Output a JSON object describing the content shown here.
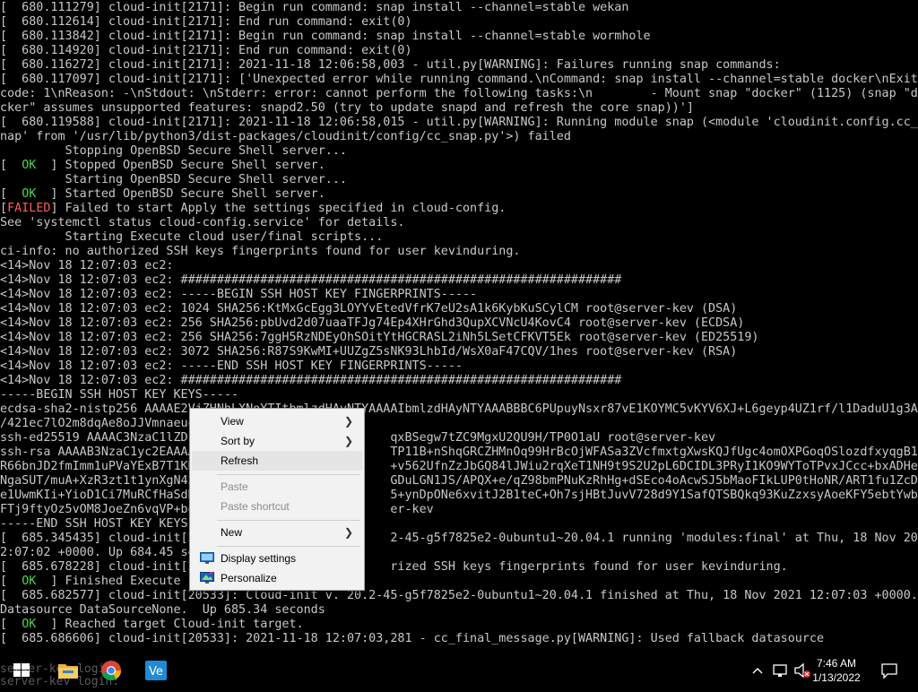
{
  "console": {
    "lines": [
      "[  680.111279] cloud-init[2171]: Begin run command: snap install --channel=stable wekan",
      "[  680.112614] cloud-init[2171]: End run command: exit(0)",
      "[  680.113842] cloud-init[2171]: Begin run command: snap install --channel=stable wormhole",
      "[  680.114920] cloud-init[2171]: End run command: exit(0)",
      "[  680.116272] cloud-init[2171]: 2021-11-18 12:06:58,003 - util.py[WARNING]: Failures running snap commands:",
      "[  680.117097] cloud-init[2171]: ['Unexpected error while running command.\\nCommand: snap install --channel=stable docker\\nExit",
      "code: 1\\nReason: -\\nStdout: \\nStderr: error: cannot perform the following tasks:\\n        - Mount snap \"docker\" (1125) (snap \"do",
      "cker\" assumes unsupported features: snapd2.50 (try to update snapd and refresh the core snap))']",
      "[  680.119588] cloud-init[2171]: 2021-11-18 12:06:58,015 - util.py[WARNING]: Running module snap (<module 'cloudinit.config.cc_s",
      "nap' from '/usr/lib/python3/dist-packages/cloudinit/config/cc_snap.py'>) failed",
      "         Stopping OpenBSD Secure Shell server...",
      "[  OK  ] Stopped OpenBSD Secure Shell server.",
      "         Starting OpenBSD Secure Shell server...",
      "[  OK  ] Started OpenBSD Secure Shell server.",
      "[FAILED] Failed to start Apply the settings specified in cloud-config.",
      "See 'systemctl status cloud-config.service' for details.",
      "         Starting Execute cloud user/final scripts...",
      "ci-info: no authorized SSH keys fingerprints found for user kevinduring.",
      "<14>Nov 18 12:07:03 ec2:",
      "<14>Nov 18 12:07:03 ec2: #############################################################",
      "<14>Nov 18 12:07:03 ec2: -----BEGIN SSH HOST KEY FINGERPRINTS-----",
      "<14>Nov 18 12:07:03 ec2: 1024 SHA256:KtMxGcEgg3LOYYvEtedVfrK7eU2sA1k6KybKuSCylCM root@server-kev (DSA)",
      "<14>Nov 18 12:07:03 ec2: 256 SHA256:pbUvd2d07uaaTFJg74Ep4XHrGhd3QupXCVNcU4KovC4 root@server-kev (ECDSA)",
      "<14>Nov 18 12:07:03 ec2: 256 SHA256:7ggH5RzNDEyOhSOitYtHGCRASL2iNh5LSetCFKVT5Ek root@server-kev (ED25519)",
      "<14>Nov 18 12:07:03 ec2: 3072 SHA256:R87S9KwMI+UUZgZ5sNK93LhbId/WsX0aF47CQV/1hes root@server-kev (RSA)",
      "<14>Nov 18 12:07:03 ec2: -----END SSH HOST KEY FINGERPRINTS-----",
      "<14>Nov 18 12:07:03 ec2: #############################################################",
      "-----BEGIN SSH HOST KEY KEYS-----",
      "ecdsa-sha2-nistp256 AAAAE2VjZHNhLXNoYTItbmlzdHAyNTYAAAAIbmlzdHAyNTYAAABBBC6PUpuyNsxr87vE1KOYMC5vKYV6XJ+L6geyp4UZ1rf/l1DaduU1g3A9",
      "/421ec7lO2m8dqAe8oJJVmnaeuo",
      "ssh-ed25519 AAAAC3NzaC1lZDI                           qxBSegw7tZC9MgxU2QU9H/TP0O1aU root@server-kev",
      "ssh-rsa AAAAB3NzaC1yc2EAAAA                           TP11B+nShqGRCZHMnOq99HrBcOjWFASa3ZVcfmxtgXwsKQJfUgc4omOXPGoqOSlozdfxyqgB1Wc2n",
      "R66bnJD2fmImm1uPVaYExB7T1KN                           +v562UfnZzJbGQ84lJWiu2rqXeT1NH9t9S2U2pL6DCIDL3PRyI1KO9WYToTPvxJCcc+bxADHewj19",
      "NgaSUT/muA+XzR3zt1t1ynXgN42                           GDuLGN1JS/APQX+e/qZ98bmPNuKzRhHg+dSEco4oAcwSJ5bMaoFIkLUP0tHoNR/ART1fu1ZcDYU+J",
      "e1UwmKIi+YioD1Ci7MuRCfHaSdH                           5+ynDpONe6xvitJ2B1teC+Oh7sjHBtJuvV728d9Y1SafQTSBQkq93KuZzxsyAoeKFY5ebtYwbT2B+",
      "FTj9ftyOz5vOM8JoeZn6vqVP+bo                           er-kev",
      "-----END SSH HOST KEY KEYS-----",
      "[  685.345435] cloud-init[2                           2-45-g5f7825e2-0ubuntu1~20.04.1 running 'modules:final' at Thu, 18 Nov 2021 1",
      "2:07:02 +0000. Up 684.45 se",
      "[  685.678228] cloud-init[2                           rized SSH keys fingerprints found for user kevinduring.",
      "[  OK  ] Finished Execute c",
      "[  685.682577] cloud-init[20533]: Cloud-init v. 20.2-45-g5f7825e2-0ubuntu1~20.04.1 finished at Thu, 18 Nov 2021 12:07:03 +0000.",
      "Datasource DataSourceNone.  Up 685.34 seconds",
      "[  OK  ] Reached target Cloud-init target.",
      "[  685.686606] cloud-init[20533]: 2021-11-18 12:07:03,281 - cc_final_message.py[WARNING]: Used fallback datasource"
    ],
    "ghost_lines": [
      "server-kev login:",
      "server-kev login:"
    ]
  },
  "context_menu": {
    "view": "View",
    "sort_by": "Sort by",
    "refresh": "Refresh",
    "paste": "Paste",
    "paste_shortcut": "Paste shortcut",
    "new": "New",
    "display_settings": "Display settings",
    "personalize": "Personalize"
  },
  "taskbar": {
    "time": "7:46 AM",
    "date": "1/13/2022",
    "pinned": [
      "windows-start",
      "file-explorer",
      "chrome",
      "vmware"
    ]
  },
  "colors": {
    "ok": "#4fd64f",
    "failed": "#ff5a5a",
    "text": "#c8c8c8"
  }
}
